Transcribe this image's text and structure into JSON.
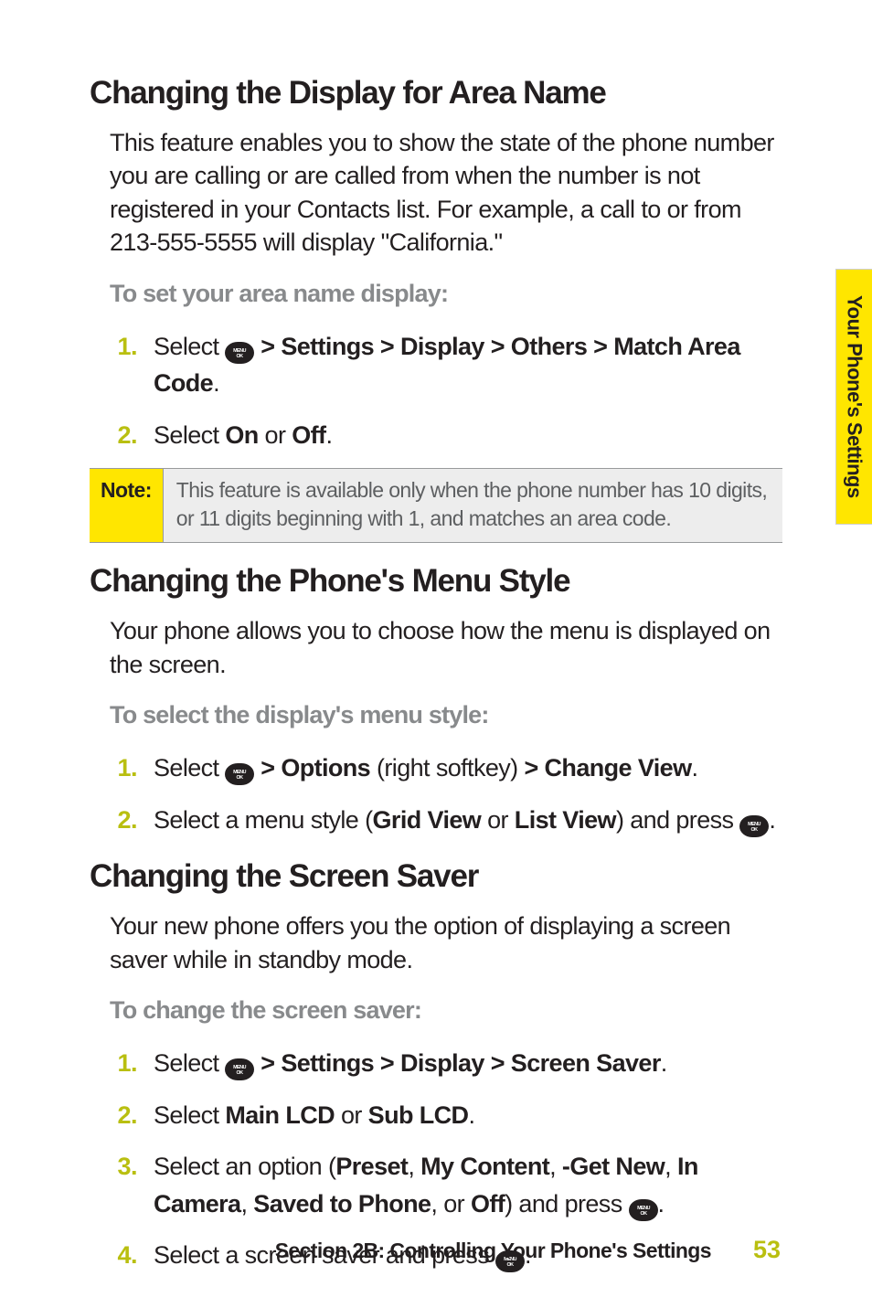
{
  "side_tab": "Your Phone's Settings",
  "sections": {
    "area_name": {
      "heading": "Changing the Display for Area Name",
      "intro": "This feature enables you to show the state of the phone number you are calling or are called from when the number is not registered in your Contacts list. For example, a call to or from 213-555-5555 will display \"California.\"",
      "lead": "To set your area name display:",
      "steps": {
        "s1_num": "1.",
        "s1_a": "Select ",
        "s1_b": " > Settings > Display > Others > Match Area Code",
        "s1_c": ".",
        "s2_num": "2.",
        "s2_a": "Select ",
        "s2_b": "On",
        "s2_c": " or ",
        "s2_d": "Off",
        "s2_e": "."
      }
    },
    "note": {
      "label": "Note:",
      "body": "This feature is available only when the phone number has 10 digits, or 11 digits beginning with 1, and matches an area code."
    },
    "menu_style": {
      "heading": "Changing the Phone's Menu Style",
      "intro": "Your phone allows you to choose how the menu is displayed on the screen.",
      "lead": "To select the display's menu style:",
      "steps": {
        "s1_num": "1.",
        "s1_a": "Select ",
        "s1_b": " > Options",
        "s1_c": " (right softkey) ",
        "s1_d": "> Change View",
        "s1_e": ".",
        "s2_num": "2.",
        "s2_a": "Select a menu style (",
        "s2_b": "Grid View",
        "s2_c": " or ",
        "s2_d": "List View",
        "s2_e": ") and press ",
        "s2_f": "."
      }
    },
    "screen_saver": {
      "heading": "Changing the Screen Saver",
      "intro": "Your new phone offers you the option of displaying a screen saver while in standby mode.",
      "lead": "To change the screen saver:",
      "steps": {
        "s1_num": "1.",
        "s1_a": "Select ",
        "s1_b": " > Settings > Display > Screen Saver",
        "s1_c": ".",
        "s2_num": "2.",
        "s2_a": "Select ",
        "s2_b": "Main LCD",
        "s2_c": " or ",
        "s2_d": "Sub LCD",
        "s2_e": ".",
        "s3_num": "3.",
        "s3_a": "Select an option (",
        "s3_b": "Preset",
        "s3_c": ", ",
        "s3_d": "My Content",
        "s3_e": ", ",
        "s3_f": "-Get New",
        "s3_g": ", ",
        "s3_h": "In Camera",
        "s3_i": ", ",
        "s3_j": "Saved to Phone",
        "s3_k": ", or ",
        "s3_l": "Off",
        "s3_m": ") and press ",
        "s3_n": ".",
        "s4_num": "4.",
        "s4_a": "Select a screen saver and press ",
        "s4_b": "."
      }
    }
  },
  "footer": {
    "title": "Section 2B: Controlling Your Phone's Settings",
    "page": "53"
  }
}
